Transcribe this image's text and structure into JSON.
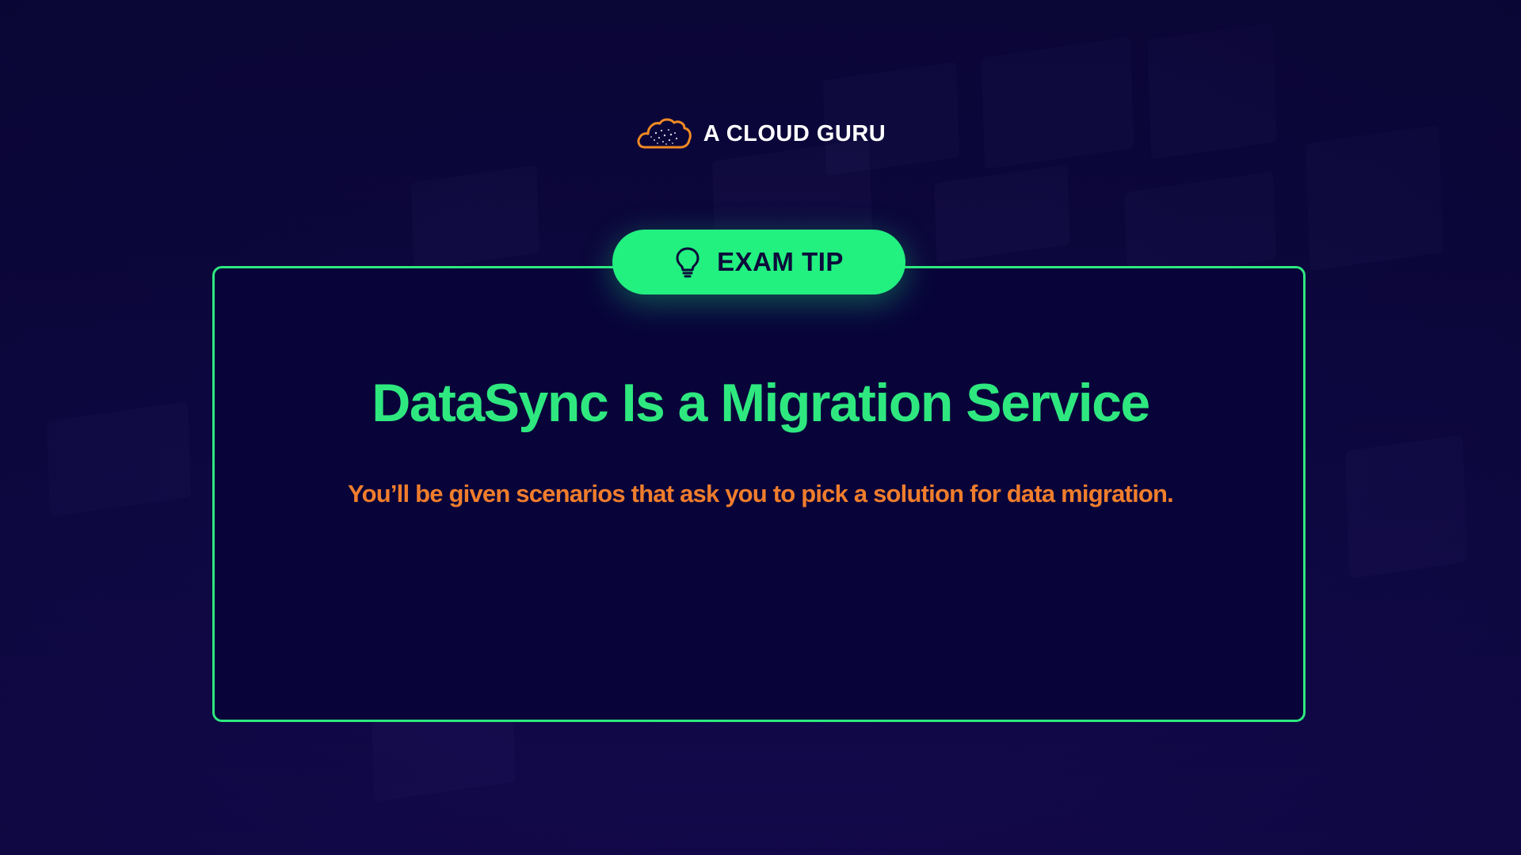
{
  "brand": {
    "name": "A CLOUD GURU",
    "logo_icon": "cloud-icon",
    "logo_color": "#f08a24"
  },
  "tip": {
    "badge_icon": "lightbulb-icon",
    "badge_label": "EXAM TIP",
    "title": "DataSync Is a Migration Service",
    "body": "You’ll be given scenarios that ask you to pick a solution for data migration."
  },
  "colors": {
    "accent_green": "#22f07f",
    "body_orange": "#f07d2c",
    "background": "#0b0638"
  }
}
